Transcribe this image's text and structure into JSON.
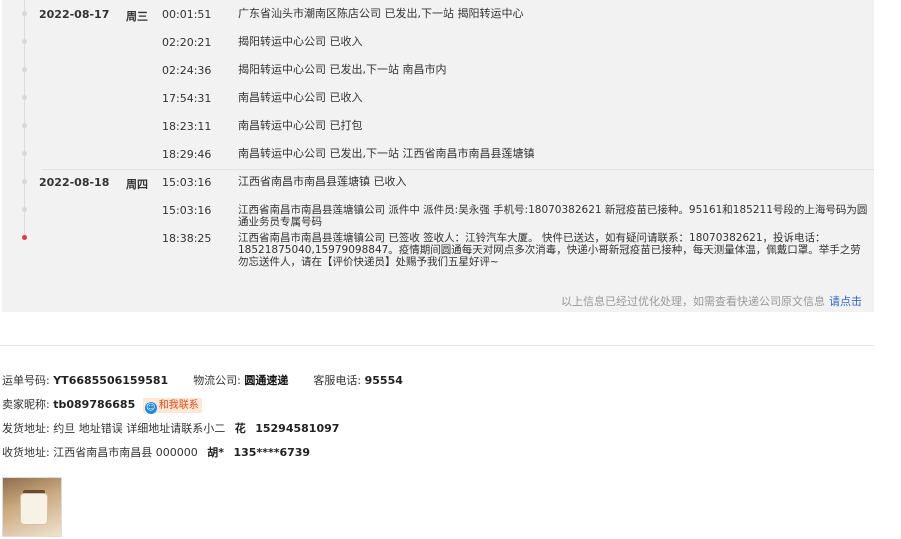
{
  "tracking": {
    "events": [
      {
        "date": "2022-08-17",
        "weekday": "周三",
        "time": "00:01:51",
        "desc": "广东省汕头市潮南区陈店公司 已发出,下一站 揭阳转运中心"
      },
      {
        "date": "",
        "weekday": "",
        "time": "02:20:21",
        "desc": "揭阳转运中心公司 已收入"
      },
      {
        "date": "",
        "weekday": "",
        "time": "02:24:36",
        "desc": "揭阳转运中心公司 已发出,下一站 南昌市内"
      },
      {
        "date": "",
        "weekday": "",
        "time": "17:54:31",
        "desc": "南昌转运中心公司 已收入"
      },
      {
        "date": "",
        "weekday": "",
        "time": "18:23:11",
        "desc": "南昌转运中心公司 已打包"
      },
      {
        "date": "",
        "weekday": "",
        "time": "18:29:46",
        "desc": "南昌转运中心公司 已发出,下一站 江西省南昌市南昌县莲塘镇"
      },
      {
        "date": "2022-08-18",
        "weekday": "周四",
        "time": "15:03:16",
        "desc": "江西省南昌市南昌县莲塘镇 已收入"
      },
      {
        "date": "",
        "weekday": "",
        "time": "15:03:16",
        "desc": "江西省南昌市南昌县莲塘镇公司 派件中 派件员:吴永强 手机号:18070382621 新冠疫苗已接种。95161和185211号段的上海号码为圆通业务员专属号码"
      },
      {
        "date": "",
        "weekday": "",
        "time": "18:38:25",
        "desc": "江西省南昌市南昌县莲塘镇公司 已签收 签收人：江铃汽车大厦。 快件已送达，如有疑问请联系：18070382621，投诉电话：18521875040,15979098847。疫情期间圆通每天对网点多次消毒，快递小哥新冠疫苗已接种，每天测量体温，佩戴口罩。举手之劳勿忘送件人，请在【评价快递员】处赐予我们五星好评~"
      }
    ],
    "note": "以上信息已经过优化处理，如需查看快递公司原文信息",
    "note_link": "请点击"
  },
  "order": {
    "waybill_label": "运单号码:",
    "waybill_value": "YT6685506159581",
    "logistics_label": "物流公司:",
    "logistics_value": "圆通速递",
    "service_label": "客服电话:",
    "service_value": "95554",
    "seller_label": "卖家昵称:",
    "seller_value": "tb089786685",
    "contact_label": "和我联系",
    "ship_label": "发货地址:",
    "ship_value": "约旦 地址错误 详细地址请联系小二",
    "ship_name": "花",
    "ship_phone": "15294581097",
    "recv_label": "收货地址:",
    "recv_value": "江西省南昌市南昌县 000000",
    "recv_name": "胡*",
    "recv_phone": "135****6739"
  },
  "colors": {
    "accent_red": "#e4393c",
    "link_blue": "#3366cc",
    "panel_bg": "#f2f2f2"
  }
}
